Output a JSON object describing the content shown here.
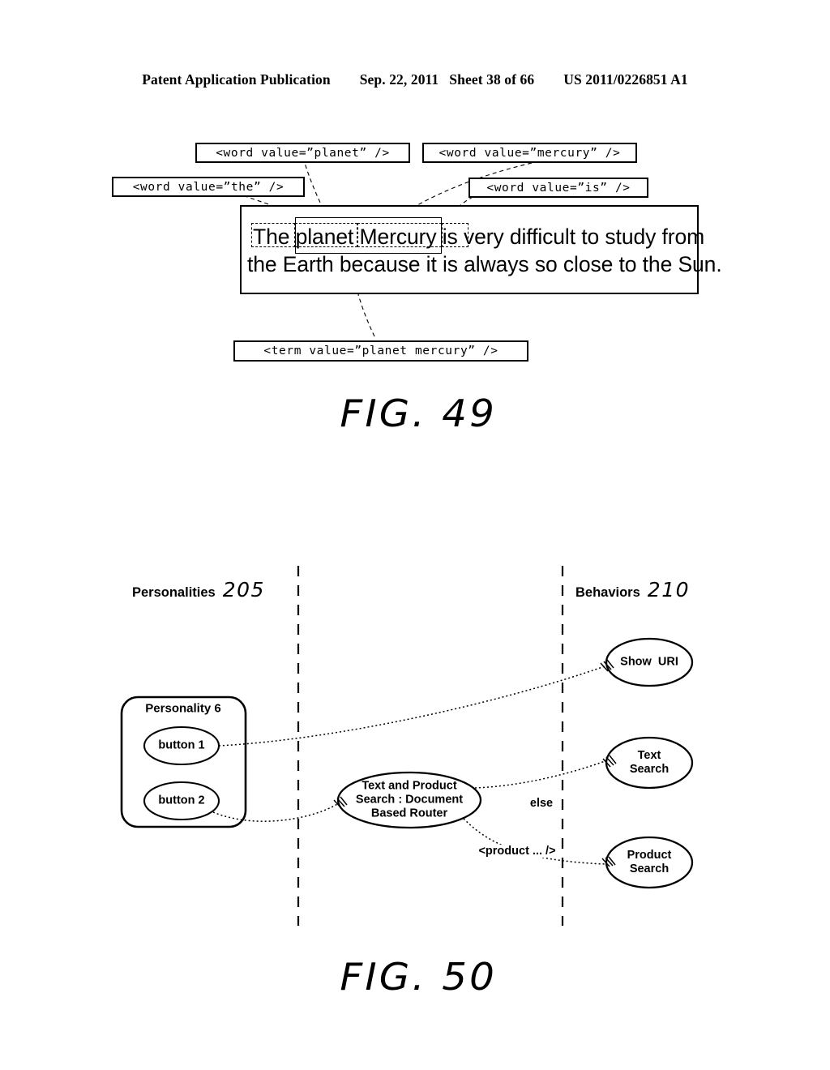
{
  "header": {
    "publication": "Patent Application Publication",
    "date": "Sep. 22, 2011",
    "sheet": "Sheet 38 of 66",
    "patent_number": "US 2011/0226851 A1"
  },
  "fig49": {
    "caption": "FIG. 49",
    "annotations": [
      {
        "id": "word-planet",
        "text": "<word value=”planet” />"
      },
      {
        "id": "word-mercury",
        "text": "<word value=”mercury” />"
      },
      {
        "id": "word-the",
        "text": "<word value=”the” />"
      },
      {
        "id": "word-is",
        "text": "<word value=”is” />"
      },
      {
        "id": "term",
        "text": "<term value=”planet mercury” />"
      }
    ],
    "sentence": {
      "line1": "The planet Mercury is very difficult to study from",
      "line2": "the Earth because it is always so close to the Sun."
    },
    "highlighted_words": [
      "The",
      "planet",
      "Mercury",
      "is"
    ],
    "highlighted_term": "planet Mercury"
  },
  "fig50": {
    "caption": "FIG. 50",
    "columns": [
      {
        "label": "Personalities",
        "ref": "205"
      },
      {
        "label": "Behaviors",
        "ref": "210"
      }
    ],
    "personality_group": {
      "title": "Personality 6",
      "buttons": [
        "button 1",
        "button 2"
      ]
    },
    "router_node": "Text and Product\nSearch : Document\nBased Router",
    "behaviors": [
      "Show  URI",
      "Text\nSearch",
      "Product\nSearch"
    ],
    "edge_labels": [
      "else",
      "<product ... />"
    ]
  }
}
